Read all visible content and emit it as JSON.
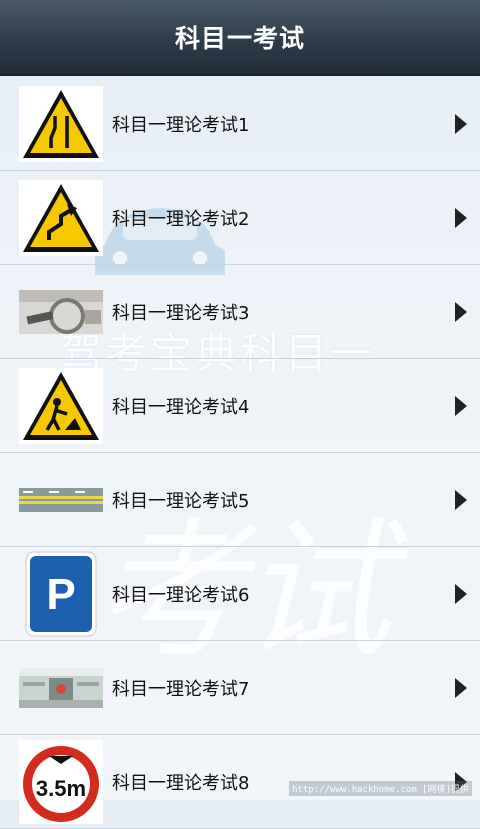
{
  "header": {
    "title": "科目一考试"
  },
  "background": {
    "watermark_text": "驾考宝典科目一",
    "big_text": "考试"
  },
  "items": [
    {
      "label": "科目一理论考试1",
      "icon": "narrow-road-warning-sign"
    },
    {
      "label": "科目一理论考试2",
      "icon": "winding-road-warning-sign"
    },
    {
      "label": "科目一理论考试3",
      "icon": "car-dashboard-photo"
    },
    {
      "label": "科目一理论考试4",
      "icon": "road-work-warning-sign"
    },
    {
      "label": "科目一理论考试5",
      "icon": "road-marking-photo"
    },
    {
      "label": "科目一理论考试6",
      "icon": "parking-sign"
    },
    {
      "label": "科目一理论考试7",
      "icon": "toll-gate-photo"
    },
    {
      "label": "科目一理论考试8",
      "icon": "height-limit-sign"
    }
  ],
  "height_limit_text": "3.5m",
  "parking_letter": "P",
  "footer_watermark": "http://www.hackhome.com [网侠]提供",
  "colors": {
    "sign_yellow": "#f5c800",
    "parking_blue": "#1f5fb0",
    "title_bg": "#2f3c4a"
  }
}
